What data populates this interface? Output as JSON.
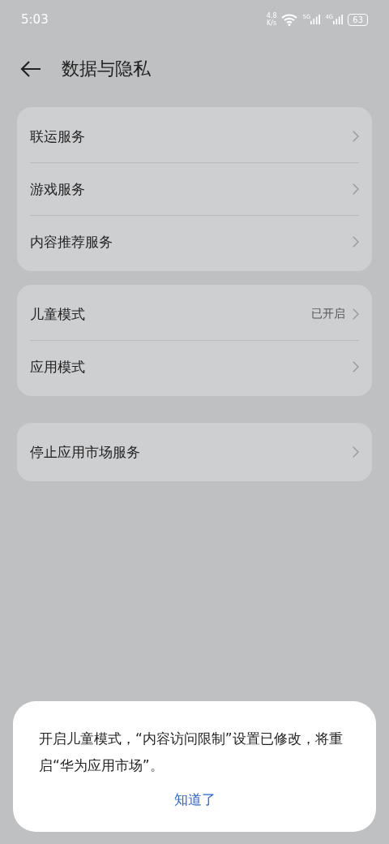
{
  "status_bar": {
    "time": "5:03",
    "speed_value": "4.8",
    "speed_unit": "K/s",
    "signals": [
      "5G",
      "4G"
    ],
    "battery": "63"
  },
  "header": {
    "title": "数据与隐私"
  },
  "groups": [
    {
      "items": [
        {
          "label": "联运服务"
        },
        {
          "label": "游戏服务"
        },
        {
          "label": "内容推荐服务"
        }
      ]
    },
    {
      "items": [
        {
          "label": "儿童模式",
          "value": "已开启"
        },
        {
          "label": "应用模式"
        }
      ]
    },
    {
      "items": [
        {
          "label": "停止应用市场服务"
        }
      ]
    }
  ],
  "dialog": {
    "message": "开启儿童模式，“内容访问限制”设置已修改，将重启“华为应用市场”。",
    "button": "知道了"
  }
}
